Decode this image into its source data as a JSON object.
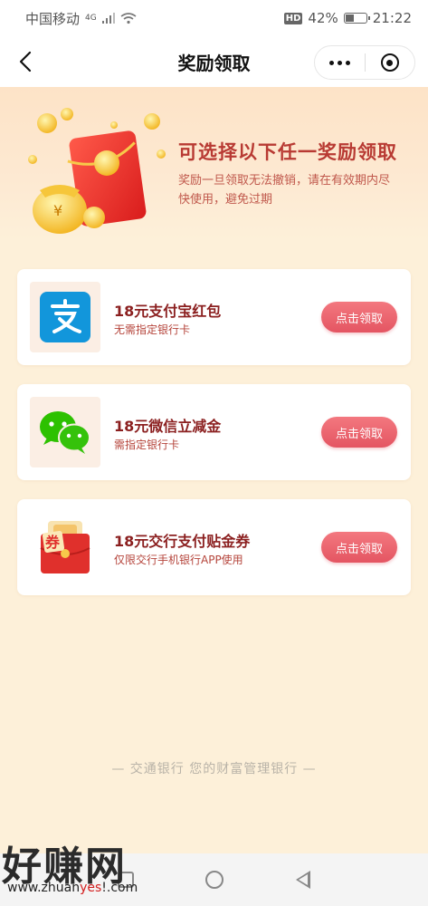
{
  "status_bar": {
    "carrier": "中国移动",
    "network": "4G",
    "battery": "42%",
    "time": "21:22"
  },
  "nav": {
    "title": "奖励领取",
    "back_icon": "chevron-left-icon",
    "more_icon": "more-dots-icon",
    "close_icon": "target-circle-icon"
  },
  "hero": {
    "title": "可选择以下任一奖励领取",
    "description": "奖励一旦领取无法撤销，请在有效期内尽快使用，避免过期",
    "accent_color": "#b83a33"
  },
  "rewards": [
    {
      "title": "18元支付宝红包",
      "subtitle": "无需指定银行卡",
      "button": "点击领取",
      "icon": "alipay-icon",
      "icon_color": "#1296db"
    },
    {
      "title": "18元微信立减金",
      "subtitle": "需指定银行卡",
      "button": "点击领取",
      "icon": "wechat-icon",
      "icon_color": "#2dc100"
    },
    {
      "title": "18元交行支付贴金券",
      "subtitle": "仅限交行手机银行APP使用",
      "button": "点击领取",
      "icon": "coupon-envelope-icon",
      "icon_color": "#e0302c"
    }
  ],
  "footer": {
    "text": "— 交通银行 您的财富管理银行 —"
  },
  "watermark": {
    "big": "好赚网",
    "small_prefix": "www.zhuan",
    "small_red": "yes",
    "small_suffix": "!.com"
  }
}
